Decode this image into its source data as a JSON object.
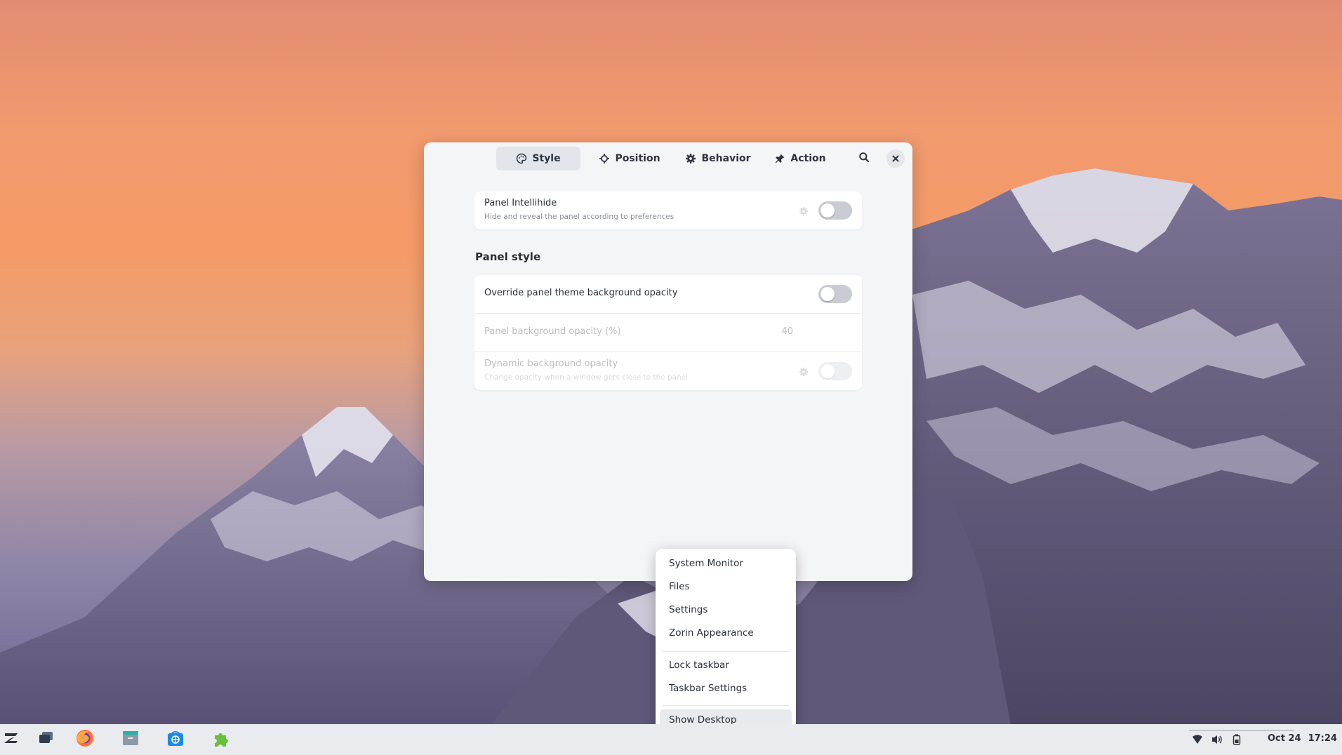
{
  "dialog": {
    "tabs": [
      {
        "label": "Style",
        "icon": "palette-icon",
        "active": true
      },
      {
        "label": "Position",
        "icon": "crosshair-icon",
        "active": false
      },
      {
        "label": "Behavior",
        "icon": "gear-icon",
        "active": false
      },
      {
        "label": "Action",
        "icon": "pin-icon",
        "active": false
      }
    ],
    "search_icon": "search-icon",
    "close_icon": "close-icon",
    "intellihide": {
      "title": "Panel Intellihide",
      "subtitle": "Hide and reveal the panel according to preferences",
      "enabled": false
    },
    "panel_style": {
      "section_title": "Panel style",
      "override_opacity": {
        "title": "Override panel theme background opacity",
        "enabled": false
      },
      "bg_opacity": {
        "title": "Panel background opacity (%)",
        "value": "40"
      },
      "dynamic_opacity": {
        "title": "Dynamic background opacity",
        "subtitle": "Change opacity when a window gets close to the panel",
        "enabled": false
      }
    }
  },
  "context_menu": {
    "items": [
      {
        "label": "System Monitor"
      },
      {
        "label": "Files"
      },
      {
        "label": "Settings"
      },
      {
        "label": "Zorin Appearance"
      },
      {
        "label": "Lock taskbar"
      },
      {
        "label": "Taskbar Settings"
      },
      {
        "label": "Show Desktop"
      }
    ]
  },
  "taskbar": {
    "apps": [
      "zorin-menu-icon",
      "workspaces-icon",
      "firefox-icon",
      "files-icon",
      "software-store-icon",
      "extensions-icon"
    ],
    "tray": [
      "wifi-icon",
      "volume-icon",
      "battery-icon"
    ],
    "date": "Oct 24",
    "time": "17:24"
  },
  "colors": {
    "accent": "#2e3440",
    "toggle_off": "#c9ccd2",
    "taskbar_bg": "#e9ebee"
  }
}
